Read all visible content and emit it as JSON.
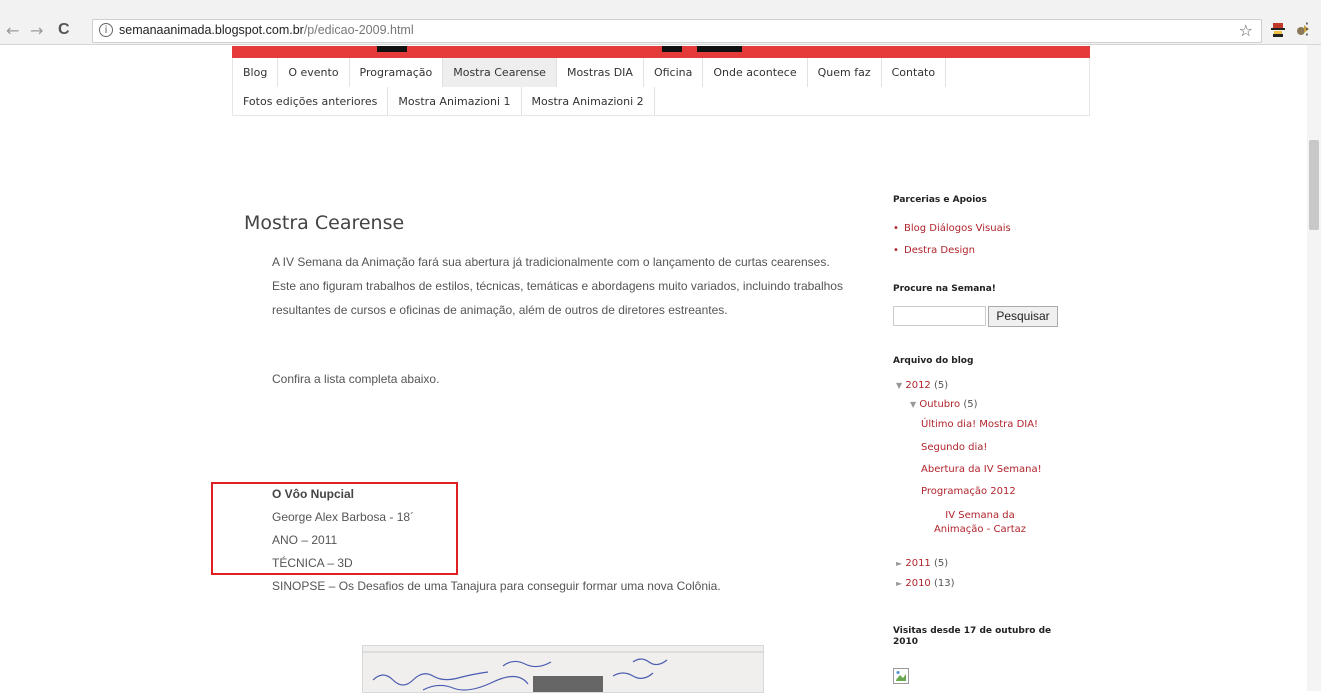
{
  "browser": {
    "back": "←",
    "forward": "→",
    "reload": "C",
    "info": "i",
    "url_host": "semanaanimada.blogspot.com.br",
    "url_path": "/p/edicao-2009.html",
    "star": "☆",
    "menu": "⋮"
  },
  "nav": {
    "row1": [
      "Blog",
      "O evento",
      "Programação",
      "Mostra Cearense",
      "Mostras DIA",
      "Oficina",
      "Onde acontece",
      "Quem faz",
      "Contato"
    ],
    "row2": [
      "Fotos edições anteriores",
      "Mostra Animazioni 1",
      "Mostra Animazioni 2"
    ],
    "active": "Mostra Cearense"
  },
  "post": {
    "title": "Mostra Cearense",
    "intro": "A IV Semana da Animação fará sua abertura já tradicionalmente com o lançamento de curtas cearenses. Este ano figuram trabalhos de estilos, técnicas, temáticas e abordagens muito variados, incluindo trabalhos resultantes de cursos e oficinas de animação, além de outros de diretores estreantes.",
    "confira": "Confira a lista completa abaixo.",
    "film": {
      "title": "O Vôo Nupcial",
      "author": "George Alex Barbosa - 18´",
      "year": "ANO – 2011",
      "technique": "TÉCNICA – 3D",
      "synopsis": "SINOPSE – Os Desafios de uma Tanajura para conseguir formar uma nova Colônia."
    }
  },
  "sidebar": {
    "partners_title": "Parcerias e Apoios",
    "partners": [
      "Blog Diálogos Visuais",
      "Destra Design"
    ],
    "search_title": "Procure na Semana!",
    "search_button": "Pesquisar",
    "archive_title": "Arquivo do blog",
    "archive": {
      "y2012": "2012",
      "y2012_count": "(5)",
      "outubro": "Outubro",
      "outubro_count": "(5)",
      "posts": [
        "Último dia! Mostra DIA!",
        "Segundo dia!",
        "Abertura da IV Semana!",
        "Programação 2012",
        "IV Semana da Animação - Cartaz"
      ],
      "y2011": "2011",
      "y2011_count": "(5)",
      "y2010": "2010",
      "y2010_count": "(13)"
    },
    "visits_title": "Visitas desde 17 de outubro de 2010"
  },
  "colors": {
    "link": "#b0242c",
    "banner_red": "#e53a3a",
    "highlight": "#e02020"
  }
}
